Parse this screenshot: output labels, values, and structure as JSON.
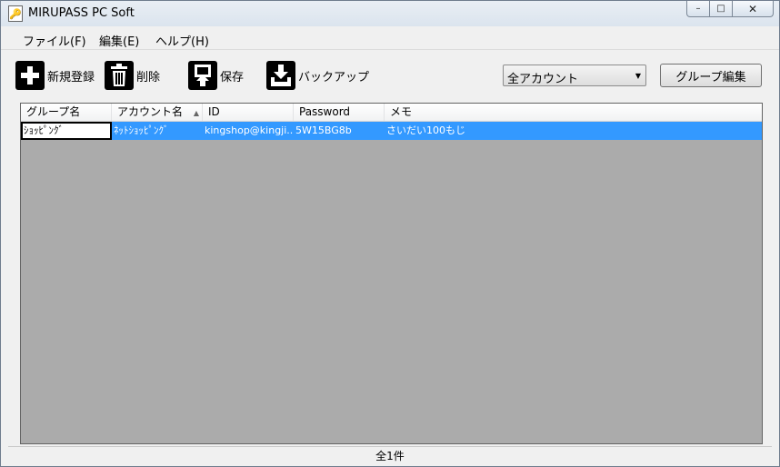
{
  "window": {
    "title": "MIRUPASS PC Soft"
  },
  "menu": [
    "ファイル(F)",
    "編集(E)",
    "ヘルプ(H)"
  ],
  "toolbar": {
    "new_label": "新規登録",
    "delete_label": "削除",
    "save_label": "保存",
    "backup_label": "バックアップ",
    "account_filter": "全アカウント",
    "group_edit_label": "グループ編集"
  },
  "grid": {
    "columns": [
      "グループ名",
      "アカウント名",
      "ID",
      "Password",
      "メモ"
    ],
    "rows": [
      [
        "ｼｮｯﾋﾟﾝｸﾞ",
        "ﾈｯﾄｼｮｯﾋﾟﾝｸﾞ",
        "kingshop@kingji...",
        "5W15BG8b",
        "さいだい100もじ"
      ]
    ]
  },
  "status": {
    "count": "全1件"
  },
  "colors": {
    "selection": "#3399ff",
    "grid_bg": "#ababab"
  }
}
